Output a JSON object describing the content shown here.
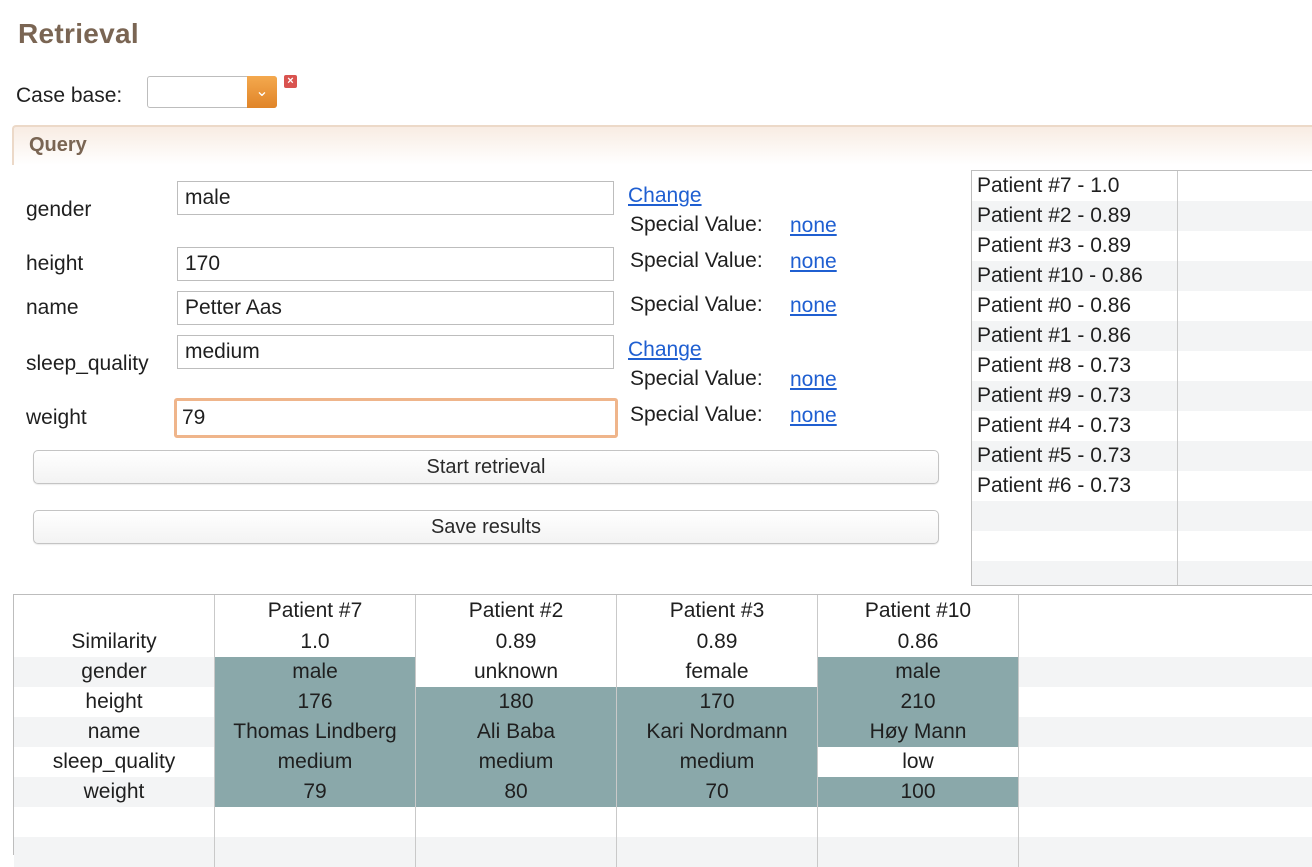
{
  "page": {
    "title": "Retrieval"
  },
  "case_base": {
    "label": "Case base:",
    "selected": "",
    "clear_icon": "close-icon"
  },
  "query": {
    "title": "Query",
    "fields": [
      {
        "label": "gender",
        "value": "male",
        "change_label": "Change",
        "special_label": "Special Value:",
        "special_value": "none"
      },
      {
        "label": "height",
        "value": "170",
        "special_label": "Special Value:",
        "special_value": "none"
      },
      {
        "label": "name",
        "value": "Petter Aas",
        "special_label": "Special Value:",
        "special_value": "none"
      },
      {
        "label": "sleep_quality",
        "value": "medium",
        "change_label": "Change",
        "special_label": "Special Value:",
        "special_value": "none"
      },
      {
        "label": "weight",
        "value": "79",
        "special_label": "Special Value:",
        "special_value": "none"
      }
    ],
    "start_button": "Start retrieval",
    "save_button": "Save results"
  },
  "results": [
    "Patient #7 - 1.0",
    "Patient #2 - 0.89",
    "Patient #3 - 0.89",
    "Patient #10 - 0.86",
    "Patient #0 - 0.86",
    "Patient #1 - 0.86",
    "Patient #8 - 0.73",
    "Patient #9 - 0.73",
    "Patient #4 - 0.73",
    "Patient #5 - 0.73",
    "Patient #6 - 0.73"
  ],
  "comparison": {
    "columns": [
      "Patient #7",
      "Patient #2",
      "Patient #3",
      "Patient #10"
    ],
    "rows": [
      {
        "label": "Similarity",
        "values": [
          "1.0",
          "0.89",
          "0.89",
          "0.86"
        ]
      },
      {
        "label": "gender",
        "values": [
          "male",
          "unknown",
          "female",
          "male"
        ]
      },
      {
        "label": "height",
        "values": [
          "176",
          "180",
          "170",
          "210"
        ]
      },
      {
        "label": "name",
        "values": [
          "Thomas Lindberg",
          "Ali Baba",
          "Kari Nordmann",
          "Høy Mann"
        ]
      },
      {
        "label": "sleep_quality",
        "values": [
          "medium",
          "medium",
          "medium",
          "low"
        ]
      },
      {
        "label": "weight",
        "values": [
          "79",
          "80",
          "70",
          "100"
        ]
      }
    ]
  },
  "colors": {
    "highlight": "#8aa8aa",
    "accent": "#e08428",
    "link": "#1f5fd1",
    "title": "#7a6553"
  }
}
